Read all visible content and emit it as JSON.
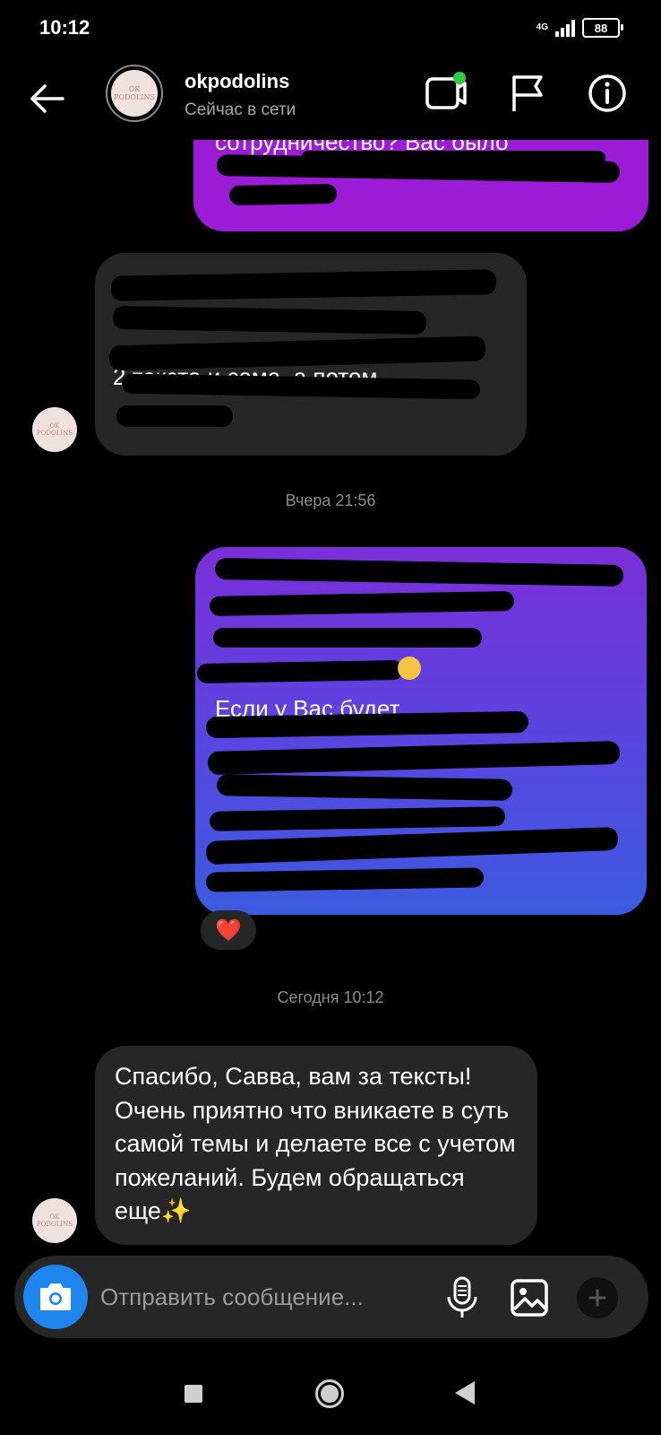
{
  "status_bar": {
    "time": "10:12",
    "network": "4G",
    "battery": "88"
  },
  "header": {
    "username": "okpodolins",
    "presence": "Сейчас в сети",
    "avatar_text_top": "OK",
    "avatar_text_bottom": "PODOLINS"
  },
  "messages": {
    "sent_1_fragment": "сотрудничество? Вас было",
    "received_1_fragment": "2 текста и сама, а потом",
    "sent_2_fragment": "Если у Вас будет",
    "timestamps": {
      "yesterday": "Вчера 21:56",
      "today": "Сегодня 10:12"
    },
    "reaction": "❤️",
    "final_message": "Спасибо, Савва, вам за тексты! Очень приятно что вникаете в суть самой темы и делаете все с учетом пожеланий. Будем обращаться еще✨"
  },
  "composer": {
    "placeholder": "Отправить сообщение..."
  },
  "colors": {
    "sent_gradient_top": "#7a2fd8",
    "sent_gradient_bottom": "#3b5be0",
    "sent_magenta": "#9b1bd6",
    "received_bg": "#262626",
    "camera_blue": "#1f86f0",
    "online_green": "#2ecc40"
  },
  "icons": [
    "back-arrow-icon",
    "video-call-icon",
    "flag-icon",
    "info-icon",
    "camera-icon",
    "microphone-icon",
    "gallery-icon",
    "plus-icon"
  ]
}
